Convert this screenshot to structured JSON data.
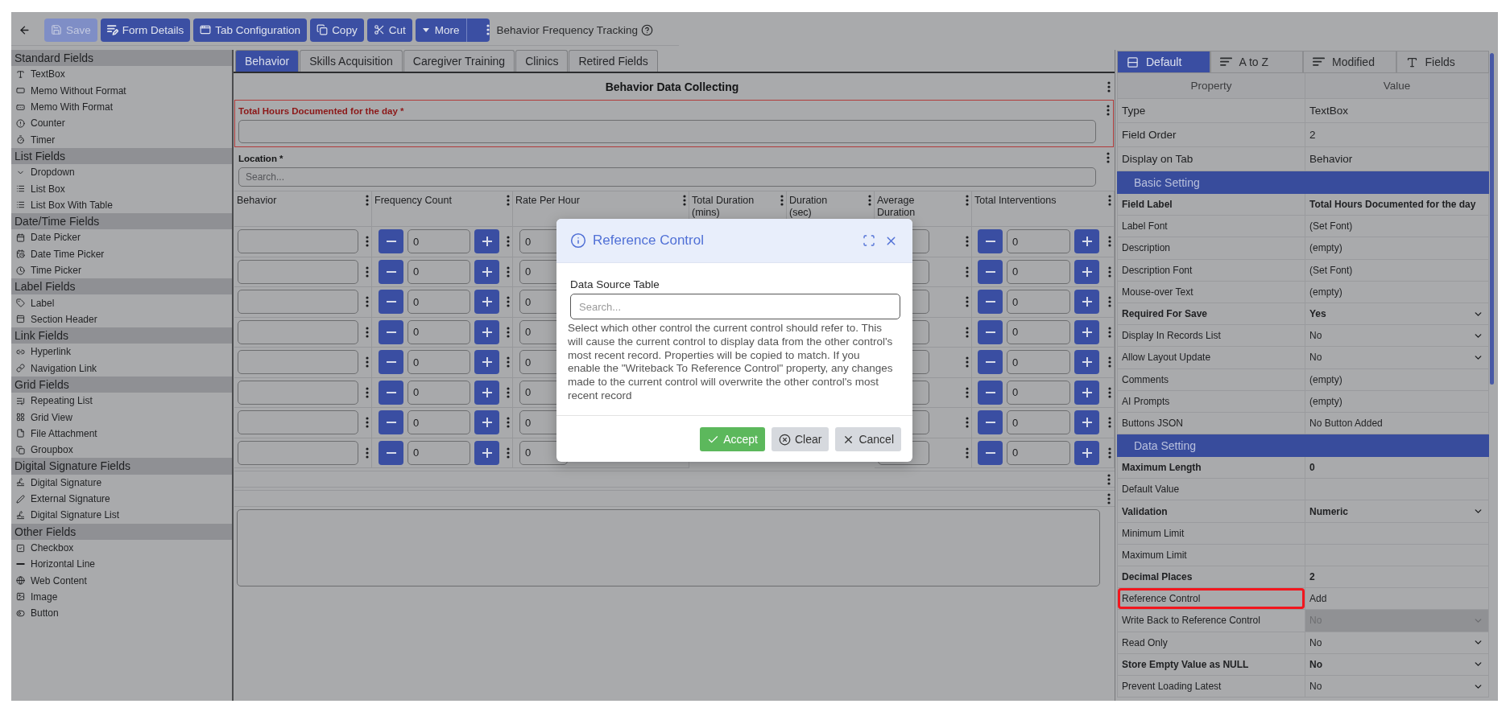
{
  "toolbar": {
    "buttons": [
      {
        "label": "Save",
        "disabled": true
      },
      {
        "label": "Form Details",
        "disabled": false
      },
      {
        "label": "Tab Configuration",
        "disabled": false
      },
      {
        "label": "Copy",
        "disabled": false
      },
      {
        "label": "Cut",
        "disabled": false
      }
    ],
    "more": {
      "label": "More"
    },
    "form_title": "Behavior Frequency Tracking"
  },
  "sidebar": {
    "groups": [
      {
        "title": "Standard Fields",
        "items": [
          {
            "label": "TextBox",
            "kind": "textbox"
          },
          {
            "label": "Memo Without Format",
            "kind": "memo"
          },
          {
            "label": "Memo With Format",
            "kind": "richmemo"
          },
          {
            "label": "Counter",
            "kind": "counter"
          },
          {
            "label": "Timer",
            "kind": "timer"
          }
        ]
      },
      {
        "title": "List Fields",
        "items": [
          {
            "label": "Dropdown",
            "kind": "dropdown"
          },
          {
            "label": "List Box",
            "kind": "listbox"
          },
          {
            "label": "List Box With Table",
            "kind": "listtable"
          }
        ]
      },
      {
        "title": "Date/Time Fields",
        "items": [
          {
            "label": "Date Picker",
            "kind": "date"
          },
          {
            "label": "Date Time Picker",
            "kind": "datetime"
          },
          {
            "label": "Time Picker",
            "kind": "time"
          }
        ]
      },
      {
        "title": "Label Fields",
        "items": [
          {
            "label": "Label",
            "kind": "label"
          },
          {
            "label": "Section Header",
            "kind": "header"
          }
        ]
      },
      {
        "title": "Link Fields",
        "items": [
          {
            "label": "Hyperlink",
            "kind": "hyperlink"
          },
          {
            "label": "Navigation Link",
            "kind": "navlink"
          }
        ]
      },
      {
        "title": "Grid Fields",
        "items": [
          {
            "label": "Repeating List",
            "kind": "repeating"
          },
          {
            "label": "Grid View",
            "kind": "grid"
          },
          {
            "label": "File Attachment",
            "kind": "file"
          },
          {
            "label": "Groupbox",
            "kind": "groupbox"
          }
        ]
      },
      {
        "title": "Digital Signature Fields",
        "items": [
          {
            "label": "Digital Signature",
            "kind": "signature"
          },
          {
            "label": "External Signature",
            "kind": "pen"
          },
          {
            "label": "Digital Signature List",
            "kind": "signaturelist"
          }
        ]
      },
      {
        "title": "Other Fields",
        "items": [
          {
            "label": "Checkbox",
            "kind": "checkbox"
          },
          {
            "label": "Horizontal Line",
            "kind": "line"
          },
          {
            "label": "Web Content",
            "kind": "web"
          },
          {
            "label": "Image",
            "kind": "image"
          },
          {
            "label": "Button",
            "kind": "button"
          }
        ]
      }
    ]
  },
  "form": {
    "tabs": [
      {
        "label": "Behavior",
        "selected": true
      },
      {
        "label": "Skills Acquisition",
        "selected": false
      },
      {
        "label": "Caregiver Training",
        "selected": false
      },
      {
        "label": "Clinics",
        "selected": false
      },
      {
        "label": "Retired Fields",
        "selected": false
      }
    ],
    "section_title": "Behavior Data Collecting",
    "fields": [
      {
        "label": "Total Hours Documented for the day *",
        "kind": "text",
        "selected": true
      },
      {
        "label": "Location *",
        "kind": "search",
        "placeholder": "Search...",
        "selected": false
      }
    ],
    "grid": {
      "columns": [
        "Behavior",
        "Frequency Count",
        "Rate Per Hour",
        "Total Duration (mins)",
        "Duration (sec)",
        "Average Duration",
        "Total Interventions"
      ],
      "rows": [
        {
          "frequency_count": "0",
          "rate_per_hour": "0",
          "total_interventions": "0"
        },
        {
          "frequency_count": "0",
          "rate_per_hour": "0",
          "total_interventions": "0"
        },
        {
          "frequency_count": "0",
          "rate_per_hour": "0",
          "total_interventions": "0"
        },
        {
          "frequency_count": "0",
          "rate_per_hour": "0",
          "total_interventions": "0"
        },
        {
          "frequency_count": "0",
          "rate_per_hour": "0",
          "total_interventions": "0"
        },
        {
          "frequency_count": "0",
          "rate_per_hour": "0",
          "total_interventions": "0"
        },
        {
          "frequency_count": "0",
          "rate_per_hour": "0",
          "total_interventions": "0"
        },
        {
          "frequency_count": "0",
          "rate_per_hour": "0",
          "total_interventions": "0"
        }
      ]
    },
    "extra_fields": [
      {
        "kind": "line"
      },
      {
        "kind": "line"
      },
      {
        "kind": "memo"
      }
    ]
  },
  "properties": {
    "tabs": [
      {
        "label": "Default",
        "selected": true
      },
      {
        "label": "A to Z",
        "selected": false
      },
      {
        "label": "Modified",
        "selected": false
      },
      {
        "label": "Fields",
        "selected": false
      }
    ],
    "columns": [
      "Property",
      "Value"
    ],
    "fixed_rows": [
      {
        "label": "Type",
        "value": "TextBox"
      },
      {
        "label": "Field Order",
        "value": "2"
      },
      {
        "label": "Display on Tab",
        "value": "Behavior"
      }
    ],
    "sections": [
      {
        "title": "Basic Setting",
        "rows": [
          {
            "label": "Field Label",
            "value": "Total Hours Documented for the day",
            "kind": "text",
            "modified": true,
            "disabled": false,
            "highlighted": false
          },
          {
            "label": "Label Font",
            "value": "(Set Font)",
            "kind": "text",
            "modified": false,
            "disabled": false,
            "highlighted": false
          },
          {
            "label": "Description",
            "value": "(empty)",
            "kind": "text",
            "modified": false,
            "disabled": false,
            "highlighted": false
          },
          {
            "label": "Description Font",
            "value": "(Set Font)",
            "kind": "text",
            "modified": false,
            "disabled": false,
            "highlighted": false
          },
          {
            "label": "Mouse-over Text",
            "value": "(empty)",
            "kind": "text",
            "modified": false,
            "disabled": false,
            "highlighted": false
          },
          {
            "label": "Required For Save",
            "value": "Yes",
            "kind": "select",
            "modified": true,
            "disabled": false,
            "highlighted": false
          },
          {
            "label": "Display In Records List",
            "value": "No",
            "kind": "select",
            "modified": false,
            "disabled": false,
            "highlighted": false
          },
          {
            "label": "Allow Layout Update",
            "value": "No",
            "kind": "select",
            "modified": false,
            "disabled": false,
            "highlighted": false
          },
          {
            "label": "Comments",
            "value": "(empty)",
            "kind": "text",
            "modified": false,
            "disabled": false,
            "highlighted": false
          },
          {
            "label": "AI Prompts",
            "value": "(empty)",
            "kind": "text",
            "modified": false,
            "disabled": false,
            "highlighted": false
          },
          {
            "label": "Buttons JSON",
            "value": "No Button Added",
            "kind": "text",
            "modified": false,
            "disabled": false,
            "highlighted": false
          }
        ]
      },
      {
        "title": "Data Setting",
        "rows": [
          {
            "label": "Maximum Length",
            "value": "0",
            "kind": "text",
            "modified": true,
            "disabled": false,
            "highlighted": false
          },
          {
            "label": "Default Value",
            "kind": "text",
            "modified": false,
            "disabled": false,
            "highlighted": false
          },
          {
            "label": "Validation",
            "value": "Numeric",
            "kind": "select",
            "modified": true,
            "disabled": false,
            "highlighted": false
          },
          {
            "label": "Minimum Limit",
            "kind": "text",
            "modified": false,
            "disabled": false,
            "highlighted": false
          },
          {
            "label": "Maximum Limit",
            "kind": "text",
            "modified": false,
            "disabled": false,
            "highlighted": false
          },
          {
            "label": "Decimal Places",
            "value": "2",
            "kind": "text",
            "modified": true,
            "disabled": false,
            "highlighted": false
          },
          {
            "label": "Reference Control",
            "value": "Add",
            "kind": "text",
            "modified": false,
            "disabled": false,
            "highlighted": true
          },
          {
            "label": "Write Back to Reference Control",
            "value": "No",
            "kind": "select",
            "modified": false,
            "disabled": true,
            "highlighted": false
          },
          {
            "label": "Read Only",
            "value": "No",
            "kind": "select",
            "modified": false,
            "disabled": false,
            "highlighted": false
          },
          {
            "label": "Store Empty Value as NULL",
            "value": "No",
            "kind": "select",
            "modified": true,
            "disabled": false,
            "highlighted": false
          },
          {
            "label": "Prevent Loading Latest",
            "value": "No",
            "kind": "select",
            "modified": false,
            "disabled": false,
            "highlighted": false
          }
        ]
      }
    ]
  },
  "dialog": {
    "title": "Reference Control",
    "field_label": "Data Source Table",
    "placeholder": "Search...",
    "description": "Select which other control the current control should refer to. This will cause the current control to display data from the other control's most recent record. Properties will be copied to match. If you enable the \"Writeback To Reference Control\" property, any changes made to the current control will overwrite the other control's most recent record",
    "buttons": [
      {
        "label": "Accept",
        "kind": "accept"
      },
      {
        "label": "Clear",
        "kind": "clear"
      },
      {
        "label": "Cancel",
        "kind": "cancel"
      }
    ]
  }
}
